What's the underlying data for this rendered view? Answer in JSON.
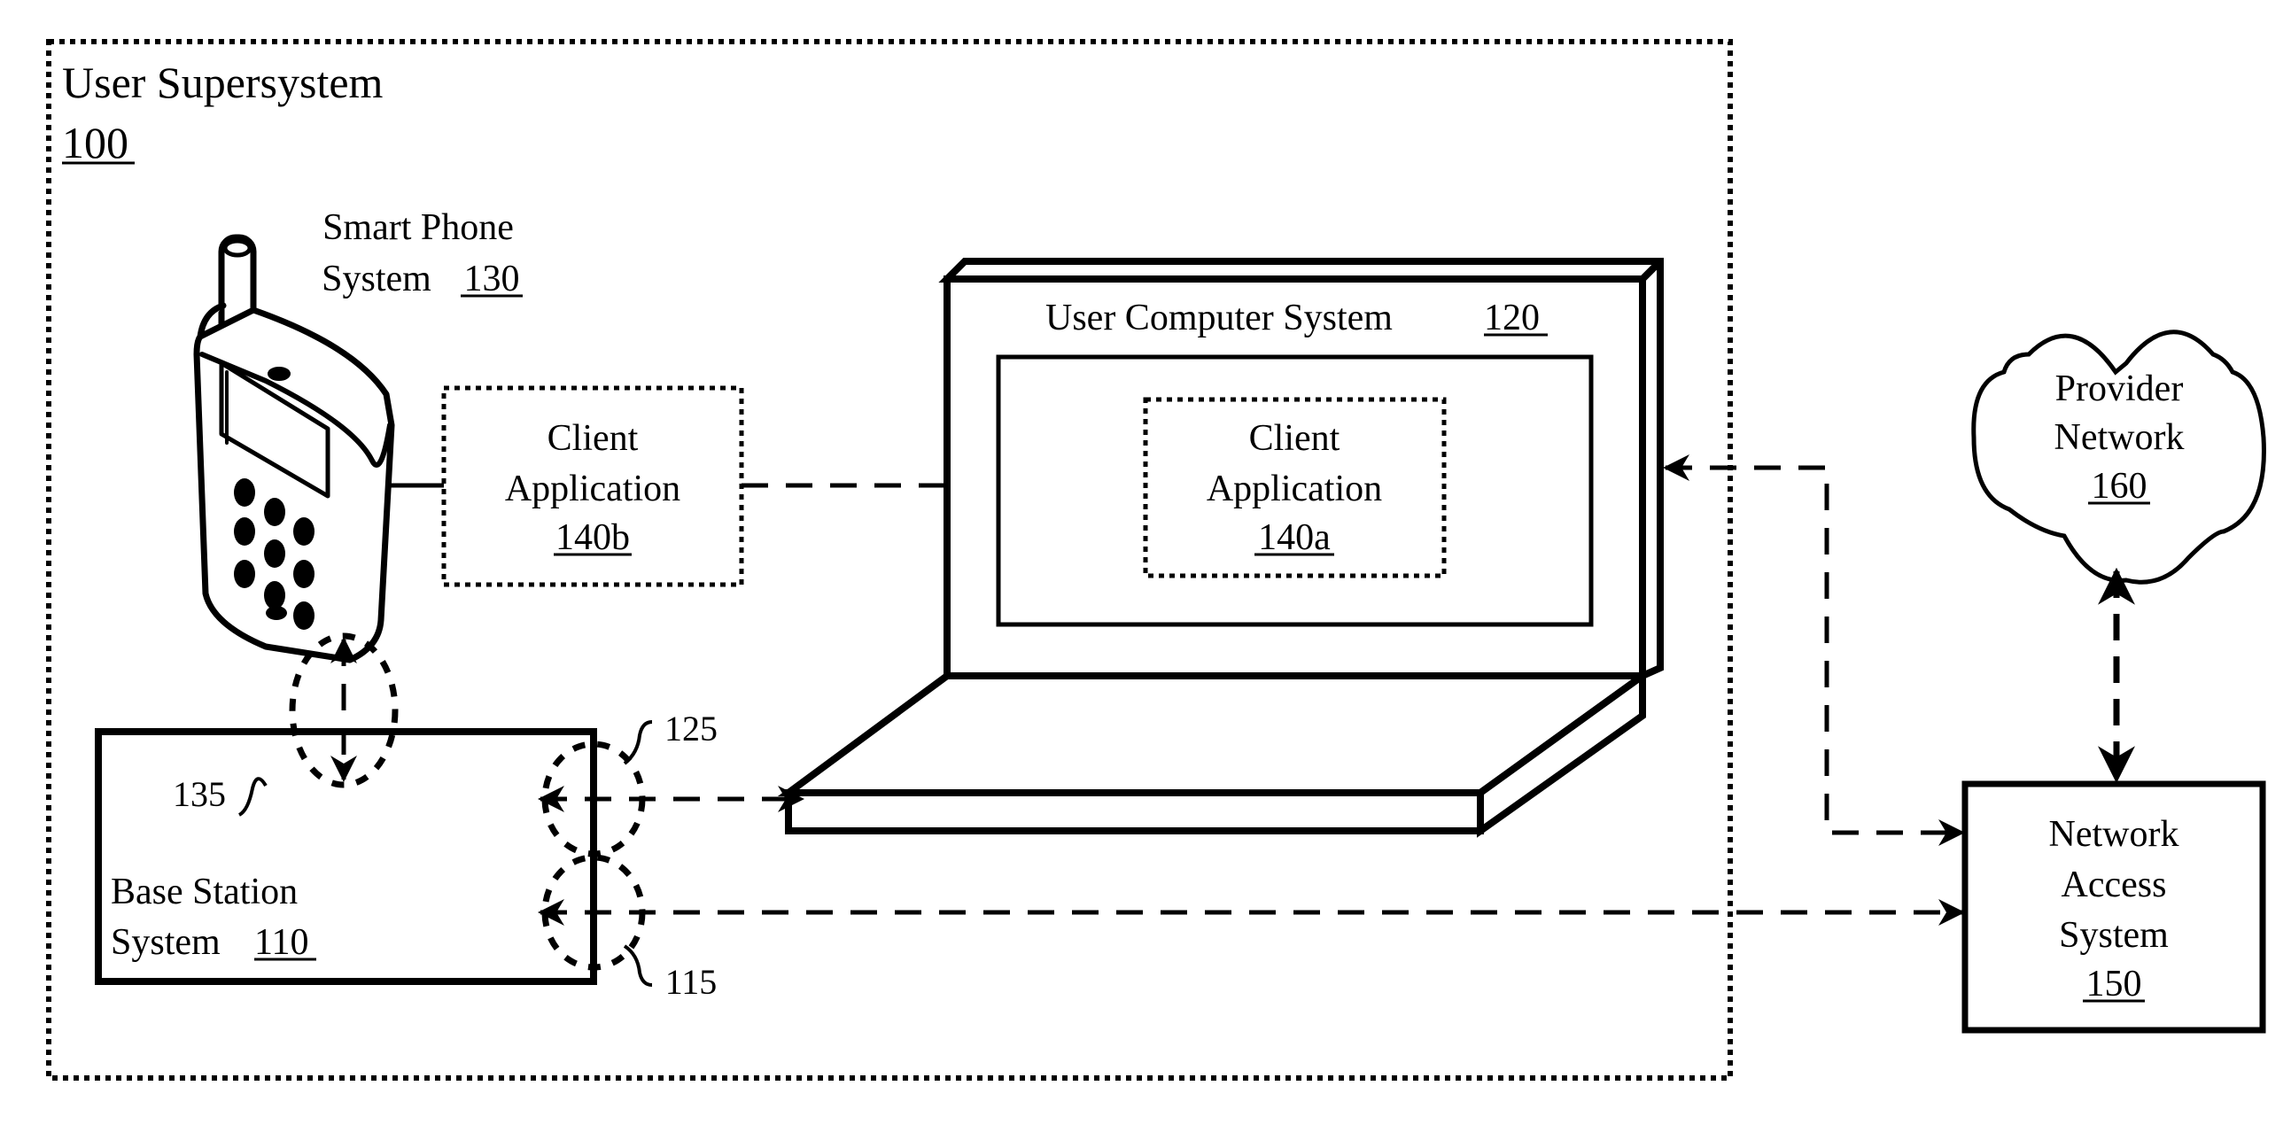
{
  "diagram": {
    "supersystem": {
      "title": "User Supersystem",
      "ref": "100"
    },
    "smart_phone": {
      "line1": "Smart Phone",
      "line2": "System",
      "ref": "130"
    },
    "client_app_b": {
      "line1": "Client",
      "line2": "Application",
      "ref": "140b"
    },
    "user_computer": {
      "title": "User Computer System",
      "ref": "120"
    },
    "client_app_a": {
      "line1": "Client",
      "line2": "Application",
      "ref": "140a"
    },
    "base_station": {
      "line1": "Base Station",
      "line2": "System",
      "ref": "110"
    },
    "provider_network": {
      "line1": "Provider",
      "line2": "Network",
      "ref": "160"
    },
    "network_access": {
      "line1": "Network",
      "line2": "Access",
      "line3": "System",
      "ref": "150"
    },
    "links": {
      "phone_base": "135",
      "base_computer": "125",
      "base_network": "115"
    },
    "colors": {
      "ink": "#000000",
      "background": "#ffffff"
    }
  }
}
